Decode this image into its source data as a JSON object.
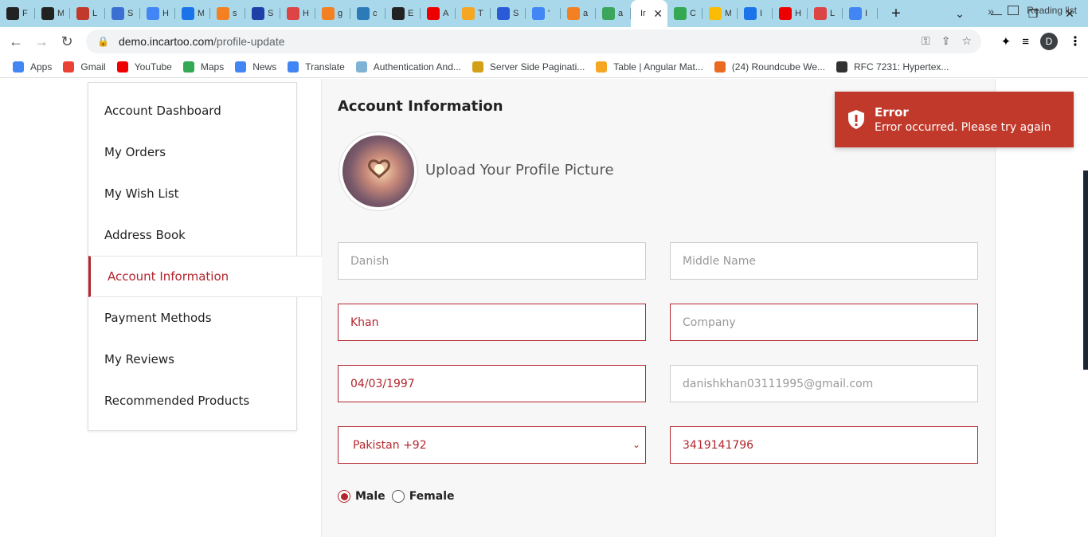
{
  "browser": {
    "tabs": [
      {
        "label": "F",
        "color": "#222"
      },
      {
        "label": "M",
        "color": "#222"
      },
      {
        "label": "L",
        "color": "#c0392b"
      },
      {
        "label": "S",
        "color": "#3b6fd4"
      },
      {
        "label": "H",
        "color": "#4285f4"
      },
      {
        "label": "M",
        "color": "#1a73e8"
      },
      {
        "label": "s",
        "color": "#f48024"
      },
      {
        "label": "S",
        "color": "#1c3fa8"
      },
      {
        "label": "H",
        "color": "#d44"
      },
      {
        "label": "g",
        "color": "#f48024"
      },
      {
        "label": "c",
        "color": "#2b7bb9"
      },
      {
        "label": "E",
        "color": "#222"
      },
      {
        "label": "A",
        "color": "#e00"
      },
      {
        "label": "T",
        "color": "#f5a623"
      },
      {
        "label": "S",
        "color": "#2a5bd7"
      },
      {
        "label": "'",
        "color": "#4285f4"
      },
      {
        "label": "a",
        "color": "#f48024"
      },
      {
        "label": "a",
        "color": "#3ba55c"
      }
    ],
    "active_tab_label": "Ir",
    "tabs_after": [
      {
        "label": "C",
        "color": "#34a853"
      },
      {
        "label": "M",
        "color": "#fbbc05"
      },
      {
        "label": "I",
        "color": "#1a73e8"
      },
      {
        "label": "H",
        "color": "#e00"
      },
      {
        "label": "L",
        "color": "#d44"
      },
      {
        "label": "I",
        "color": "#4285f4"
      }
    ],
    "url_host": "demo.incartoo.com",
    "url_path": "/profile-update",
    "profile_initial": "D",
    "bookmarks": [
      {
        "label": "Apps",
        "color": "#4285f4"
      },
      {
        "label": "Gmail",
        "color": "#ea4335"
      },
      {
        "label": "YouTube",
        "color": "#e00"
      },
      {
        "label": "Maps",
        "color": "#34a853"
      },
      {
        "label": "News",
        "color": "#4285f4"
      },
      {
        "label": "Translate",
        "color": "#4285f4"
      },
      {
        "label": "Authentication And...",
        "color": "#7fb3d5"
      },
      {
        "label": "Server Side Paginati...",
        "color": "#d4a017"
      },
      {
        "label": "Table | Angular Mat...",
        "color": "#f5a623"
      },
      {
        "label": "(24) Roundcube We...",
        "color": "#e86b1f"
      },
      {
        "label": "RFC 7231: Hypertex...",
        "color": "#333"
      }
    ],
    "more_label": "»",
    "reading_list": "Reading list"
  },
  "sidebar": {
    "items": [
      {
        "label": "Account Dashboard"
      },
      {
        "label": "My Orders"
      },
      {
        "label": "My Wish List"
      },
      {
        "label": "Address Book"
      },
      {
        "label": "Account Information"
      },
      {
        "label": "Payment Methods"
      },
      {
        "label": "My Reviews"
      },
      {
        "label": "Recommended Products"
      }
    ],
    "active_index": 4
  },
  "main": {
    "title": "Account Information",
    "upload_text": "Upload Your Profile Picture",
    "fields": {
      "first_name": {
        "placeholder": "Danish",
        "value": ""
      },
      "middle_name": {
        "placeholder": "Middle Name",
        "value": ""
      },
      "last_name": {
        "value": "Khan"
      },
      "company": {
        "placeholder": "Company",
        "value": ""
      },
      "dob": {
        "value": "04/03/1997"
      },
      "email": {
        "value": "danishkhan03111995@gmail.com"
      },
      "country_code": {
        "value": "Pakistan +92"
      },
      "phone": {
        "value": "3419141796"
      }
    },
    "gender": {
      "options": [
        "Male",
        "Female"
      ],
      "selected": "Male"
    }
  },
  "toast": {
    "title": "Error",
    "message": "Error occurred. Please try again",
    "color": "#c0392b"
  },
  "colors": {
    "accent": "#b3262e",
    "tabstrip": "#a8d8ea"
  }
}
